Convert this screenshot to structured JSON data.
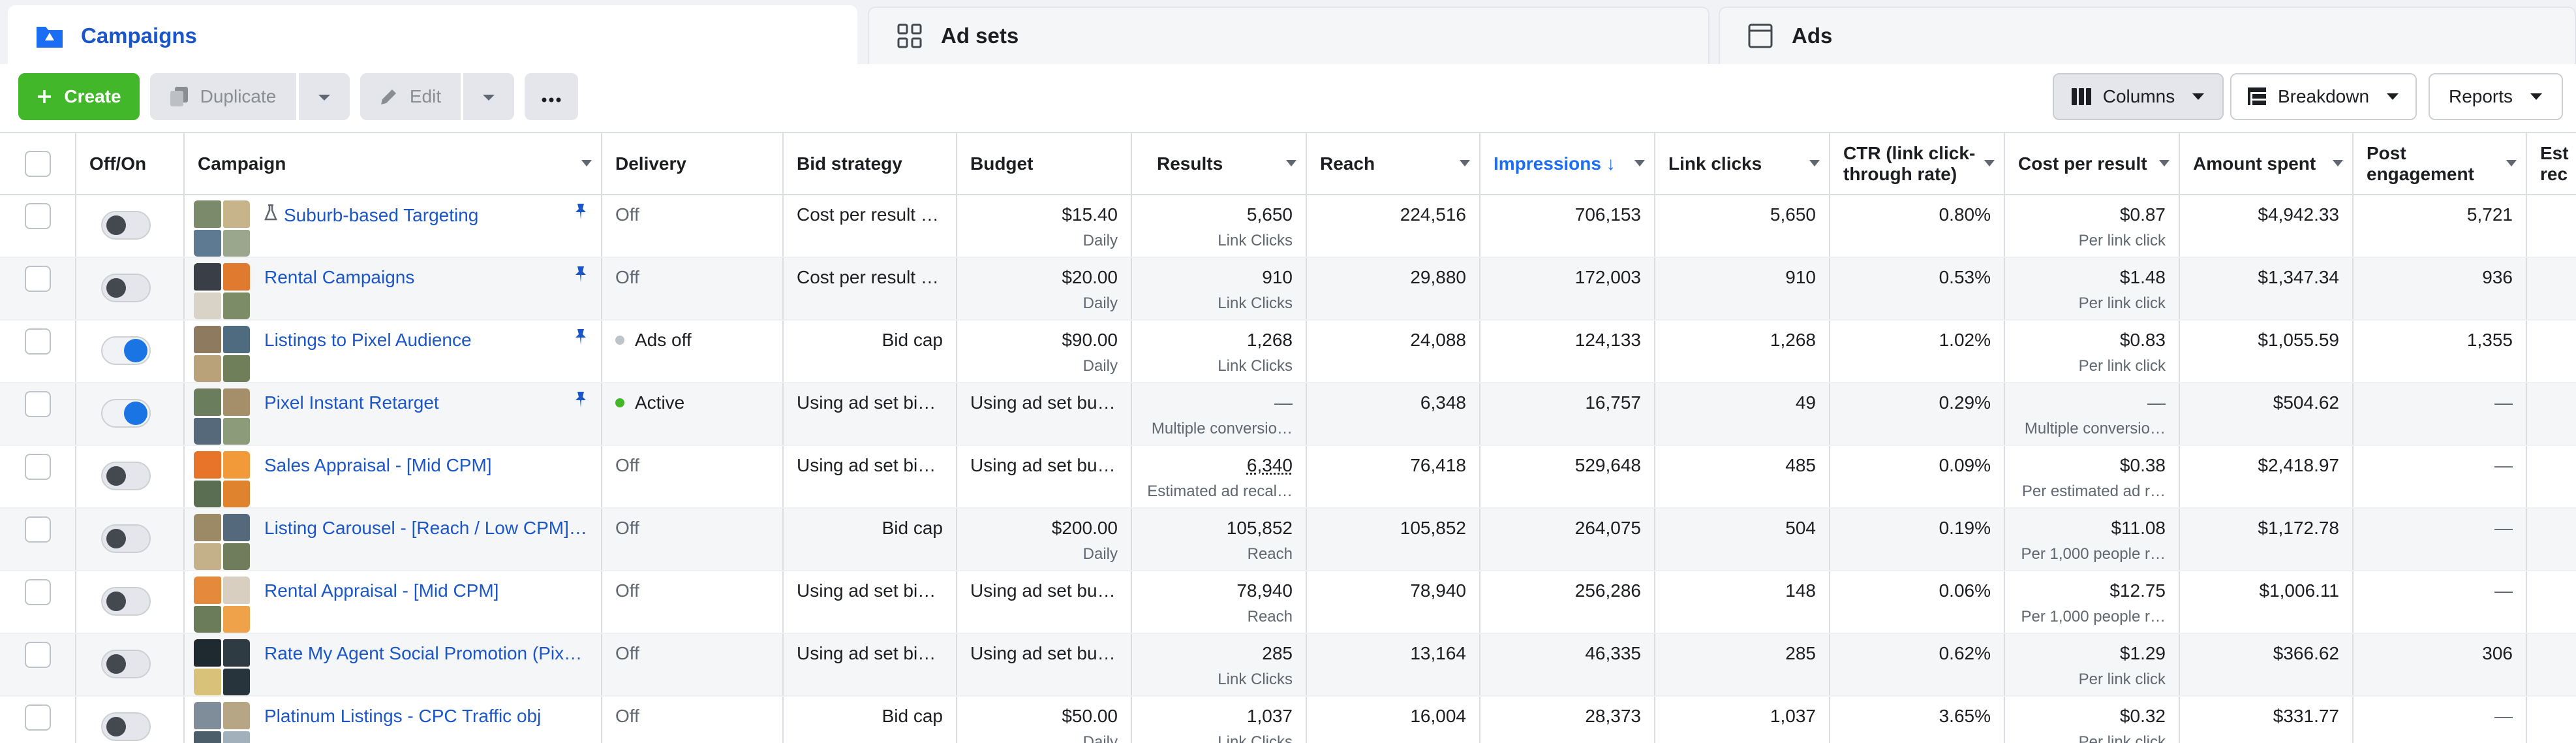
{
  "tabs": [
    {
      "label": "Campaigns",
      "icon": "campaign-folder-icon",
      "active": true
    },
    {
      "label": "Ad sets",
      "icon": "adsets-grid-icon",
      "active": false
    },
    {
      "label": "Ads",
      "icon": "ads-page-icon",
      "active": false
    }
  ],
  "toolbar": {
    "create_label": "Create",
    "duplicate_label": "Duplicate",
    "edit_label": "Edit",
    "columns_label": "Columns",
    "breakdown_label": "Breakdown",
    "reports_label": "Reports"
  },
  "columns": {
    "offon": "Off/On",
    "campaign": "Campaign",
    "delivery": "Delivery",
    "bid_strategy": "Bid strategy",
    "budget": "Budget",
    "results": "Results",
    "reach": "Reach",
    "impressions": "Impressions",
    "impressions_sort": "↓",
    "link_clicks": "Link clicks",
    "ctr_line1": "CTR (link click-",
    "ctr_line2": "through rate)",
    "cost_per_result": "Cost per result",
    "amount_spent": "Amount spent",
    "post_engagement_line1": "Post",
    "post_engagement_line2": "engagement",
    "est_line1": "Est",
    "est_line2": "rec"
  },
  "colors": {
    "accent": "#1b56c9",
    "create_green": "#42b72a",
    "toggle_on": "#1b74e4",
    "active_dot": "#42b72a",
    "ads_off_dot": "#bec3c9"
  },
  "rows": [
    {
      "on": false,
      "name": "Suburb-based Targeting",
      "flask": true,
      "pinned": true,
      "delivery": "Off",
      "delivery_dot": "",
      "bid": "Cost per result …",
      "bid_align": "left",
      "budget": "$15.40",
      "budget_sub": "Daily",
      "results": "5,650",
      "results_sub": "Link Clicks",
      "reach": "224,516",
      "impressions": "706,153",
      "link_clicks": "5,650",
      "ctr": "0.80%",
      "cpr": "$0.87",
      "cpr_sub": "Per link click",
      "spent": "$4,942.33",
      "engagement": "5,721",
      "thumb": [
        "#7a8a6a",
        "#c8b48a",
        "#5d7a92",
        "#9aa78c"
      ]
    },
    {
      "on": false,
      "name": "Rental Campaigns",
      "flask": false,
      "pinned": true,
      "delivery": "Off",
      "delivery_dot": "",
      "bid": "Cost per result …",
      "bid_align": "left",
      "budget": "$20.00",
      "budget_sub": "Daily",
      "results": "910",
      "results_sub": "Link Clicks",
      "reach": "29,880",
      "impressions": "172,003",
      "link_clicks": "910",
      "ctr": "0.53%",
      "cpr": "$1.48",
      "cpr_sub": "Per link click",
      "spent": "$1,347.34",
      "engagement": "936",
      "thumb": [
        "#3a3f47",
        "#e07a2f",
        "#d9d3c7",
        "#7b8c66"
      ]
    },
    {
      "on": true,
      "name": "Listings to Pixel Audience",
      "flask": false,
      "pinned": true,
      "delivery": "Ads off",
      "delivery_dot": "gray",
      "bid": "Bid cap",
      "bid_align": "right",
      "budget": "$90.00",
      "budget_sub": "Daily",
      "results": "1,268",
      "results_sub": "Link Clicks",
      "reach": "24,088",
      "impressions": "124,133",
      "link_clicks": "1,268",
      "ctr": "1.02%",
      "cpr": "$0.83",
      "cpr_sub": "Per link click",
      "spent": "$1,055.59",
      "engagement": "1,355",
      "thumb": [
        "#8e7b5f",
        "#4f6b80",
        "#b9a27a",
        "#6f7f5a"
      ]
    },
    {
      "on": true,
      "name": "Pixel Instant Retarget",
      "flask": false,
      "pinned": true,
      "delivery": "Active",
      "delivery_dot": "green",
      "bid": "Using ad set bid…",
      "bid_align": "left",
      "budget": "Using ad set bu…",
      "budget_sub": "",
      "results": "—",
      "results_sub": "Multiple conversio…",
      "reach": "6,348",
      "impressions": "16,757",
      "link_clicks": "49",
      "ctr": "0.29%",
      "cpr": "—",
      "cpr_sub": "Multiple conversio…",
      "spent": "$504.62",
      "engagement": "—",
      "thumb": [
        "#6a7d5c",
        "#a58f6b",
        "#56697a",
        "#8c9b7a"
      ]
    },
    {
      "on": false,
      "name": "Sales Appraisal - [Mid CPM]",
      "flask": false,
      "pinned": false,
      "delivery": "Off",
      "delivery_dot": "",
      "bid": "Using ad set bid…",
      "bid_align": "left",
      "budget": "Using ad set bu…",
      "budget_sub": "",
      "results": "6,340",
      "results_sub": "Estimated ad recal…",
      "results_dotted": true,
      "reach": "76,418",
      "impressions": "529,648",
      "link_clicks": "485",
      "ctr": "0.09%",
      "cpr": "$0.38",
      "cpr_sub": "Per estimated ad r…",
      "spent": "$2,418.97",
      "engagement": "—",
      "thumb": [
        "#e8742a",
        "#f29a3a",
        "#5a6e52",
        "#e0832f"
      ]
    },
    {
      "on": false,
      "name": "Listing Carousel - [Reach / Low CPM]…",
      "flask": false,
      "pinned": false,
      "delivery": "Off",
      "delivery_dot": "",
      "bid": "Bid cap",
      "bid_align": "right",
      "budget": "$200.00",
      "budget_sub": "Daily",
      "results": "105,852",
      "results_sub": "Reach",
      "reach": "105,852",
      "impressions": "264,075",
      "link_clicks": "504",
      "ctr": "0.19%",
      "cpr": "$11.08",
      "cpr_sub": "Per 1,000 people r…",
      "spent": "$1,172.78",
      "engagement": "—",
      "thumb": [
        "#9c8a66",
        "#54697c",
        "#c4b089",
        "#707d5d"
      ]
    },
    {
      "on": false,
      "name": "Rental Appraisal - [Mid CPM]",
      "flask": false,
      "pinned": false,
      "delivery": "Off",
      "delivery_dot": "",
      "bid": "Using ad set bid…",
      "bid_align": "left",
      "budget": "Using ad set bu…",
      "budget_sub": "",
      "results": "78,940",
      "results_sub": "Reach",
      "reach": "78,940",
      "impressions": "256,286",
      "link_clicks": "148",
      "ctr": "0.06%",
      "cpr": "$12.75",
      "cpr_sub": "Per 1,000 people r…",
      "spent": "$1,006.11",
      "engagement": "—",
      "thumb": [
        "#e58a3c",
        "#d8cfc0",
        "#6b7c5b",
        "#f0a24a"
      ]
    },
    {
      "on": false,
      "name": "Rate My Agent Social Promotion (Pix…",
      "flask": false,
      "pinned": false,
      "delivery": "Off",
      "delivery_dot": "",
      "bid": "Using ad set bid…",
      "bid_align": "left",
      "budget": "Using ad set bu…",
      "budget_sub": "",
      "results": "285",
      "results_sub": "Link Clicks",
      "reach": "13,164",
      "impressions": "46,335",
      "link_clicks": "285",
      "ctr": "0.62%",
      "cpr": "$1.29",
      "cpr_sub": "Per link click",
      "spent": "$366.62",
      "engagement": "306",
      "thumb": [
        "#1f2a30",
        "#2e3b42",
        "#d8c27a",
        "#27343b"
      ]
    },
    {
      "on": false,
      "name": "Platinum Listings - CPC Traffic obj",
      "flask": false,
      "pinned": false,
      "delivery": "Off",
      "delivery_dot": "",
      "bid": "Bid cap",
      "bid_align": "right",
      "budget": "$50.00",
      "budget_sub": "Daily",
      "results": "1,037",
      "results_sub": "Link Clicks",
      "reach": "16,004",
      "impressions": "28,373",
      "link_clicks": "1,037",
      "ctr": "3.65%",
      "cpr": "$0.32",
      "cpr_sub": "Per link click",
      "spent": "$331.77",
      "engagement": "—",
      "thumb": [
        "#7f8d9a",
        "#b6a686",
        "#4d5e6b",
        "#a2b0bb"
      ]
    }
  ]
}
